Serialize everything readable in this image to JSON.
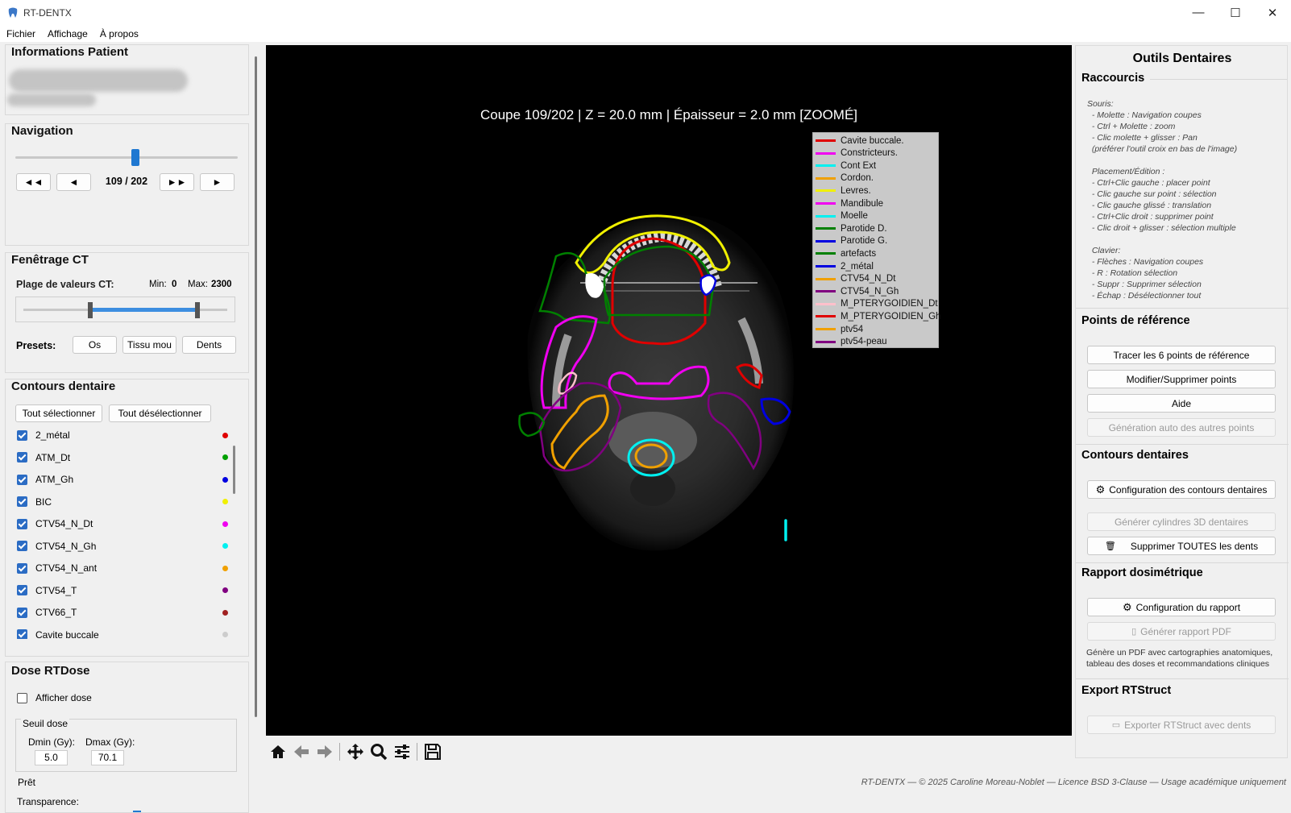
{
  "window": {
    "title": "RT-DENTX"
  },
  "menu": {
    "items": [
      "Fichier",
      "Affichage",
      "À propos"
    ]
  },
  "left": {
    "patient": {
      "title": "Informations Patient"
    },
    "navigation": {
      "title": "Navigation",
      "slider_value": 0.54,
      "first_label": "◄◄",
      "prev_label": "◄",
      "slice_label": "109 / 202",
      "next_fast_label": "►►",
      "next_label": "►"
    },
    "windowing": {
      "title": "Fenêtrage CT",
      "range_label": "Plage de valeurs CT:",
      "min_label": "Min:",
      "min_value": "0",
      "max_label": "Max:",
      "max_value": "2300",
      "presets_label": "Presets:",
      "preset_os": "Os",
      "preset_soft": "Tissu mou",
      "preset_teeth": "Dents"
    },
    "contours": {
      "title": "Contours dentaire",
      "select_all": "Tout sélectionner",
      "deselect_all": "Tout désélectionner",
      "items": [
        {
          "label": "2_métal",
          "color": "#e00000"
        },
        {
          "label": "ATM_Dt",
          "color": "#00a000"
        },
        {
          "label": "ATM_Gh",
          "color": "#0000e0"
        },
        {
          "label": "BIC",
          "color": "#f0f000"
        },
        {
          "label": "CTV54_N_Dt",
          "color": "#f000f0"
        },
        {
          "label": "CTV54_N_Gh",
          "color": "#00f0f0"
        },
        {
          "label": "CTV54_N_ant",
          "color": "#f0a000"
        },
        {
          "label": "CTV54_T",
          "color": "#800080"
        },
        {
          "label": "CTV66_T",
          "color": "#a02020"
        },
        {
          "label": "Cavite buccale",
          "color": "#cccccc"
        }
      ]
    },
    "dose": {
      "title": "Dose RTDose",
      "show_dose": "Afficher dose",
      "threshold_title": "Seuil dose",
      "dmin_label": "Dmin (Gy):",
      "dmin_value": "5.0",
      "dmax_label": "Dmax (Gy):",
      "dmax_value": "70.1",
      "transparency_label": "Transparence:"
    }
  },
  "viewer": {
    "title": "Coupe 109/202 | Z = 20.0 mm | Épaisseur = 2.0 mm [ZOOMÉ]",
    "legend": [
      {
        "label": "Cavite buccale.",
        "color": "#e00000"
      },
      {
        "label": "Constricteurs.",
        "color": "#f000f0"
      },
      {
        "label": "Cont Ext",
        "color": "#00f0f0"
      },
      {
        "label": "Cordon.",
        "color": "#f0a000"
      },
      {
        "label": "Levres.",
        "color": "#f0f000"
      },
      {
        "label": "Mandibule",
        "color": "#f000f0"
      },
      {
        "label": "Moelle",
        "color": "#00f0f0"
      },
      {
        "label": "Parotide D.",
        "color": "#008000"
      },
      {
        "label": "Parotide G.",
        "color": "#0000e0"
      },
      {
        "label": "artefacts",
        "color": "#008000"
      },
      {
        "label": "2_métal",
        "color": "#0000e0"
      },
      {
        "label": "CTV54_N_Dt",
        "color": "#f0a000"
      },
      {
        "label": "CTV54_N_Gh",
        "color": "#800080"
      },
      {
        "label": "M_PTERYGOIDIEN_Dt",
        "color": "#ffc0cb"
      },
      {
        "label": "M_PTERYGOIDIEN_Gh",
        "color": "#e00000"
      },
      {
        "label": "ptv54",
        "color": "#f0a000"
      },
      {
        "label": "ptv54-peau",
        "color": "#800080"
      }
    ]
  },
  "right": {
    "title": "Outils Dentaires",
    "shortcuts_title": "Raccourcis",
    "shortcuts": [
      "Souris:",
      "  - Molette : Navigation coupes",
      "  - Ctrl + Molette : zoom",
      "  - Clic molette + glisser : Pan",
      "  (préférer l'outil croix en bas de l'image)",
      "",
      "  Placement/Édition :",
      "  - Ctrl+Clic gauche : placer point",
      "  - Clic gauche sur point : sélection",
      "  - Clic gauche glissé : translation",
      "  - Ctrl+Clic droit : supprimer point",
      "  - Clic droit + glisser : sélection multiple",
      "",
      "  Clavier:",
      "  - Flèches : Navigation coupes",
      "  - R : Rotation sélection",
      "  - Suppr : Supprimer sélection",
      "  - Échap : Désélectionner tout"
    ],
    "ref_title": "Points de référence",
    "ref_trace": "Tracer les 6 points de référence",
    "ref_edit": "Modifier/Supprimer points",
    "ref_help": "Aide",
    "ref_auto": "Génération auto des autres points",
    "contours_title": "Contours dentaires",
    "contours_config": "Configuration des contours dentaires",
    "contours_cyl": "Générer cylindres 3D dentaires",
    "contours_delete": "Supprimer TOUTES les dents",
    "report_title": "Rapport dosimétrique",
    "report_config": "Configuration du rapport",
    "report_pdf": "Générer rapport PDF",
    "report_note": "Génère un PDF avec cartographies anatomiques, tableau des doses et recommandations cliniques",
    "export_title": "Export RTStruct",
    "export_btn": "Exporter RTStruct avec dents"
  },
  "status": {
    "left": "Prêt",
    "right": "RT-DENTX — © 2025 Caroline Moreau-Noblet — Licence BSD 3-Clause — Usage académique uniquement"
  }
}
